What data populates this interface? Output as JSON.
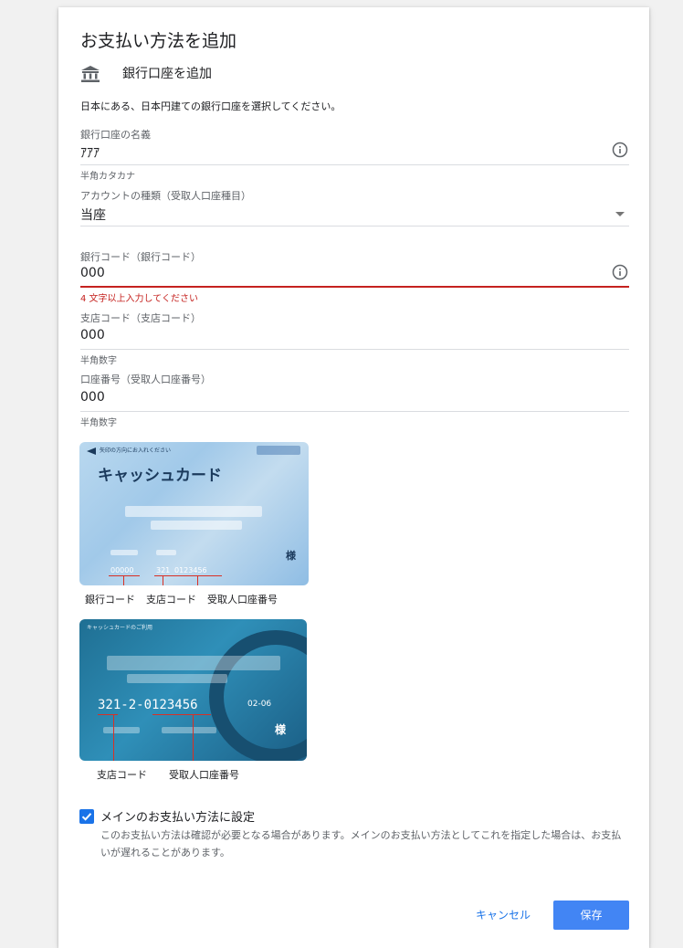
{
  "dialog": {
    "title": "お支払い方法を追加",
    "method_label": "銀行口座を追加",
    "instruction": "日本にある、日本円建ての銀行口座を選択してください。"
  },
  "fields": {
    "account_name": {
      "label": "銀行口座の名義",
      "value": "ｱｱｱ",
      "helper": "半角カタカナ"
    },
    "account_type": {
      "label": "アカウントの種類（受取人口座種目）",
      "value": "当座"
    },
    "bank_code": {
      "label": "銀行コード（銀行コード）",
      "value": "000",
      "error": "4 文字以上入力してください"
    },
    "branch_code": {
      "label": "支店コード（支店コード）",
      "value": "000",
      "helper": "半角数字"
    },
    "account_number": {
      "label": "口座番号（受取人口座番号）",
      "value": "000",
      "helper": "半角数字"
    }
  },
  "card1": {
    "header": "矢印の方向にお入れください",
    "title": "キャッシュカード",
    "code_bank": "00000",
    "code_branch": "321",
    "code_account": "0123456",
    "sama": "様",
    "captions": [
      "銀行コード",
      "支店コード",
      "受取人口座番号"
    ]
  },
  "card2": {
    "header": "キャッシュカードのご利用",
    "number": "321-2-0123456",
    "expiry": "02-06",
    "sama": "様",
    "captions": [
      "支店コード",
      "受取人口座番号"
    ]
  },
  "default_option": {
    "checked": true,
    "label": "メインのお支払い方法に設定",
    "description": "このお支払い方法は確認が必要となる場合があります。メインのお支払い方法としてこれを指定した場合は、お支払いが遅れることがあります。"
  },
  "buttons": {
    "cancel": "キャンセル",
    "save": "保存"
  },
  "colors": {
    "accent": "#1a73e8",
    "save_bg": "#4285f4",
    "error": "#c5221f"
  }
}
